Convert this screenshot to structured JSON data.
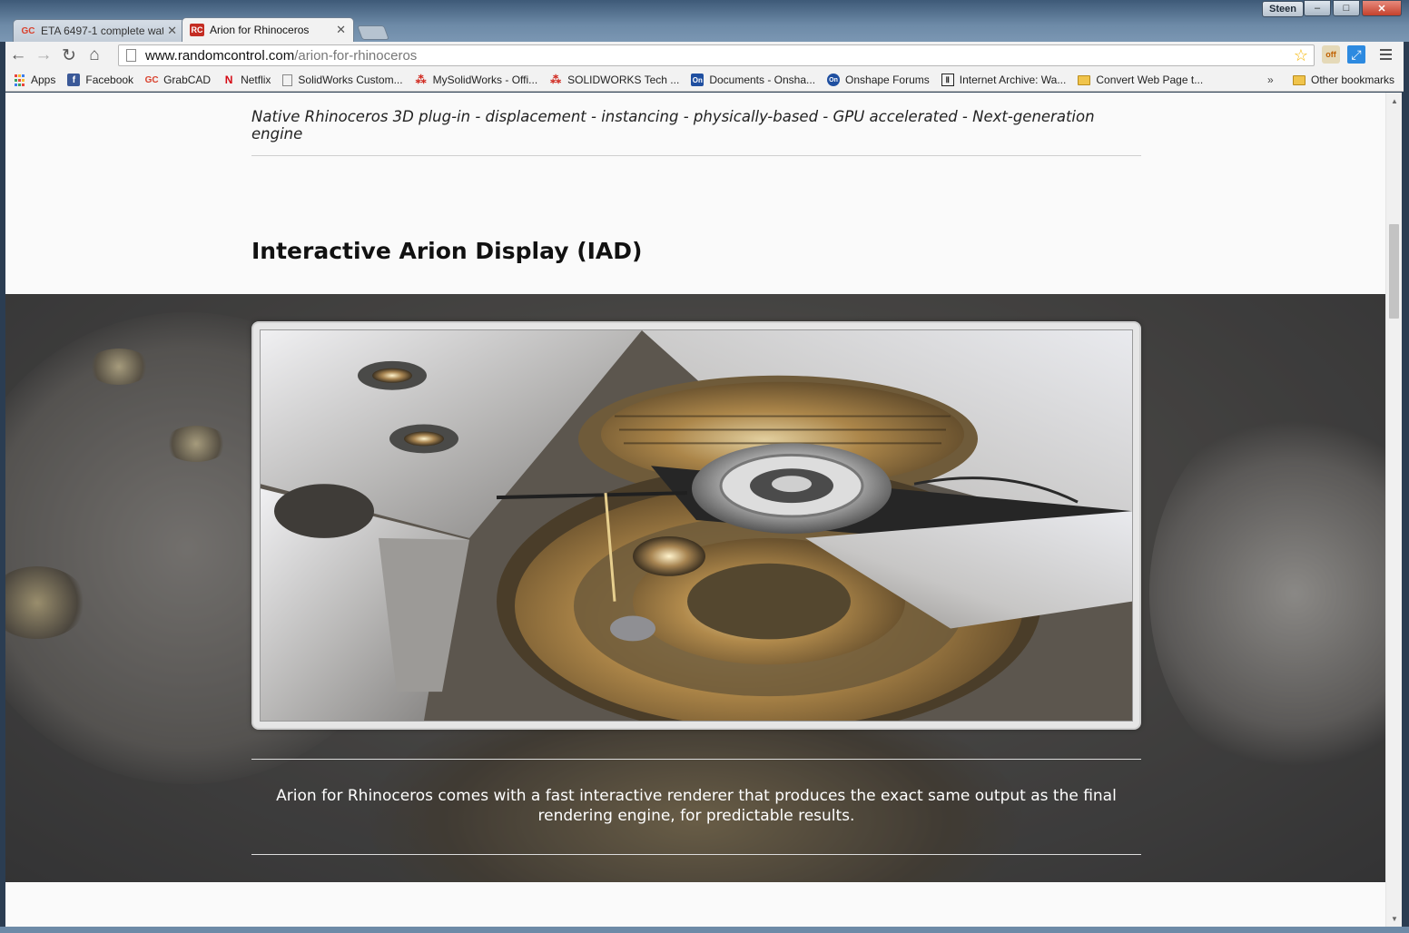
{
  "window": {
    "user_label": "Steen",
    "controls": [
      "–",
      "□",
      "✕"
    ]
  },
  "tabs": [
    {
      "favicon": "GC",
      "title": "ETA 6497-1 complete watc",
      "active": false
    },
    {
      "favicon": "RC",
      "title": "Arion for Rhinoceros",
      "active": true
    }
  ],
  "toolbar": {
    "url_domain": "www.randomcontrol.com",
    "url_path": "/arion-for-rhinoceros",
    "ext_off_label": "off"
  },
  "bookmarks": {
    "items": [
      {
        "icon": "apps-icon",
        "label": "Apps"
      },
      {
        "icon": "facebook-icon",
        "glyph": "f",
        "label": "Facebook"
      },
      {
        "icon": "grabcad-icon",
        "glyph": "GC",
        "label": "GrabCAD"
      },
      {
        "icon": "netflix-icon",
        "glyph": "N",
        "label": "Netflix"
      },
      {
        "icon": "page-icon",
        "glyph": "",
        "label": "SolidWorks Custom..."
      },
      {
        "icon": "solidworks-icon",
        "glyph": "⁂",
        "label": "MySolidWorks - Offi..."
      },
      {
        "icon": "solidworks-icon",
        "glyph": "⁂",
        "label": "SOLIDWORKS Tech ..."
      },
      {
        "icon": "onshape-icon",
        "glyph": "On",
        "label": "Documents - Onsha..."
      },
      {
        "icon": "onshape-round-icon",
        "glyph": "On",
        "label": "Onshape Forums"
      },
      {
        "icon": "internet-archive-icon",
        "glyph": "Ⅱ",
        "label": "Internet Archive: Wa..."
      },
      {
        "icon": "folder-icon",
        "glyph": "",
        "label": "Convert Web Page t..."
      }
    ],
    "more": "»",
    "other": "Other bookmarks"
  },
  "page": {
    "tagline": "Native Rhinoceros 3D plug-in - displacement - instancing - physically-based - GPU accelerated - Next-generation engine",
    "section_title": "Interactive Arion Display (IAD)",
    "hero_text": "Arion for Rhinoceros comes with a fast interactive renderer that produces the exact same output as the final rendering engine, for predictable results."
  },
  "colors": {
    "window_frame": "#6d8aa7",
    "page_bg": "#fafafa",
    "hero_text": "#ffffff",
    "brand_red": "#c42d23"
  }
}
